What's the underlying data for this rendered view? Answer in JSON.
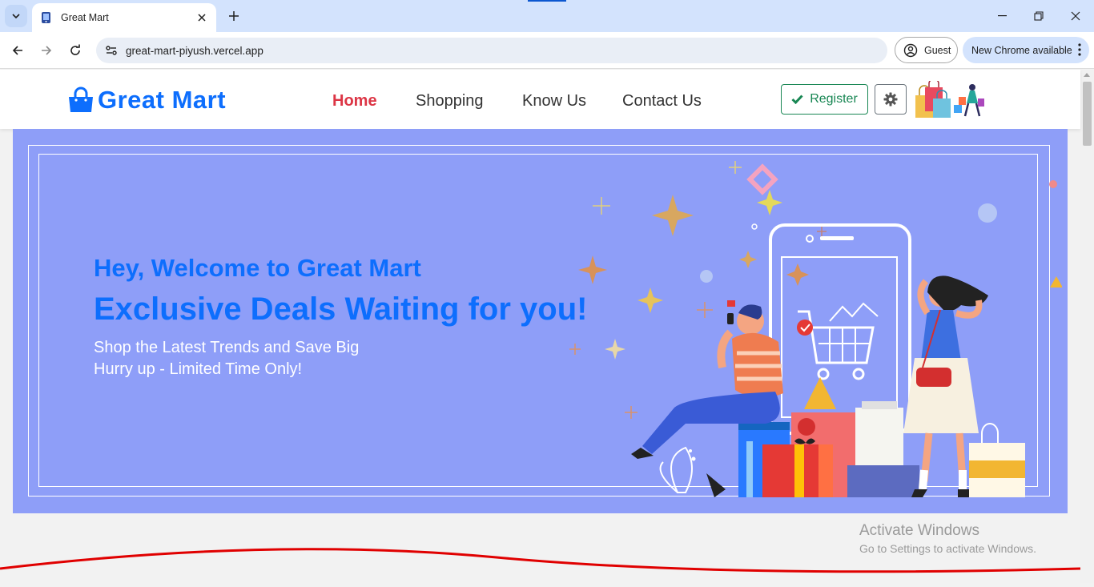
{
  "browser": {
    "tab_title": "Great Mart",
    "url": "great-mart-piyush.vercel.app",
    "profile_label": "Guest",
    "update_label": "New Chrome available"
  },
  "site": {
    "brand": "Great Mart",
    "menu": [
      "Home",
      "Shopping",
      "Know Us",
      "Contact Us"
    ],
    "active_menu": "Home",
    "register_label": "Register"
  },
  "hero": {
    "greeting": "Hey, Welcome to Great Mart",
    "headline": "Exclusive Deals Waiting for you!",
    "line1": "Shop the Latest Trends and Save Big",
    "line2": "Hurry up - Limited Time Only!"
  },
  "watermark": {
    "title": "Activate Windows",
    "subtitle": "Go to Settings to activate Windows."
  },
  "colors": {
    "brand": "#0d6efd",
    "active": "#dc3545",
    "success": "#198754",
    "hero_bg": "#8e9ef8",
    "chrome_frame": "#d3e3fd"
  },
  "icons": [
    "tab-search-icon",
    "favicon-icon",
    "close-icon",
    "plus-icon",
    "minimize-icon",
    "restore-icon",
    "window-close-icon",
    "back-icon",
    "forward-icon",
    "reload-icon",
    "site-info-icon",
    "profile-icon",
    "kebab-icon",
    "shopping-bag-icon",
    "check-icon",
    "gear-icon"
  ]
}
